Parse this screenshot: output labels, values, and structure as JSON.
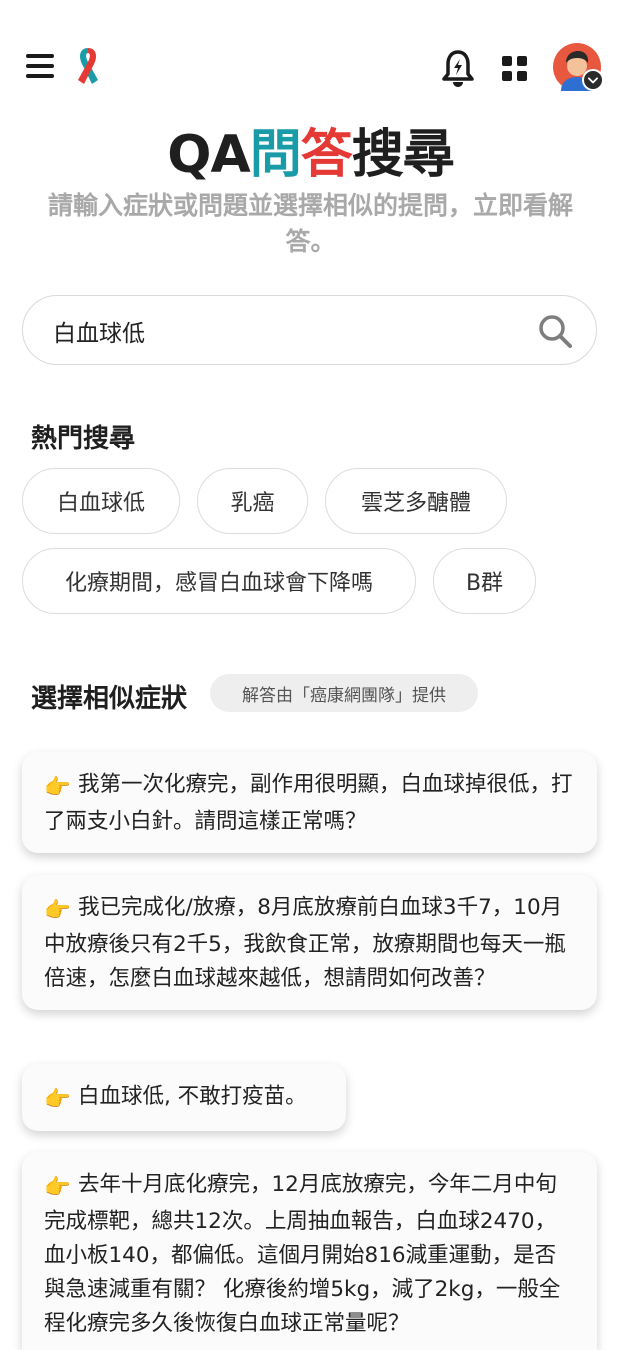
{
  "header": {
    "title_part1": "QA",
    "title_part2": "問",
    "title_part3": "答",
    "title_part4": "搜尋",
    "subtitle": "請輸入症狀或問題並選擇相似的提問，立即看解答。",
    "icons": [
      "menu-icon",
      "ribbon-logo-icon",
      "notification-bell-icon",
      "apps-grid-icon",
      "avatar-icon"
    ]
  },
  "search": {
    "value": "白血球低",
    "icon": "search-icon"
  },
  "popular": {
    "heading": "熱門搜尋",
    "chips": [
      "白血球低",
      "乳癌",
      "雲芝多醣體",
      "化療期間，感冒白血球會下降嗎",
      "B群"
    ]
  },
  "similar": {
    "heading": "選擇相似症狀",
    "provider": "解答由「癌康網團隊」提供",
    "questions": [
      "我第一次化療完，副作用很明顯，白血球掉很低，打了兩支小白針。請問這樣正常嗎？",
      "我已完成化/放療，8月底放療前白血球3千7，10月中放療後只有2千5，我飲食正常，放療期間也每天一瓶倍速，怎麼白血球越來越低，想請問如何改善？",
      "白血球低, 不敢打疫苗。",
      "去年十月底化療完，12月底放療完，今年二月中旬完成標靶，總共12次。上周抽血報告，白血球2470，血小板140，都偏低。這個月開始816減重運動，是否與急速減重有關？ 化療後約增5kg，減了2kg，一般全程化療完多久後恢復白血球正常量呢？"
    ]
  },
  "colors": {
    "title_teal": "#1a9ba8",
    "title_red": "#e53935",
    "subtitle_gray": "#a9a9a9",
    "chip_border": "#dcdcdc"
  }
}
